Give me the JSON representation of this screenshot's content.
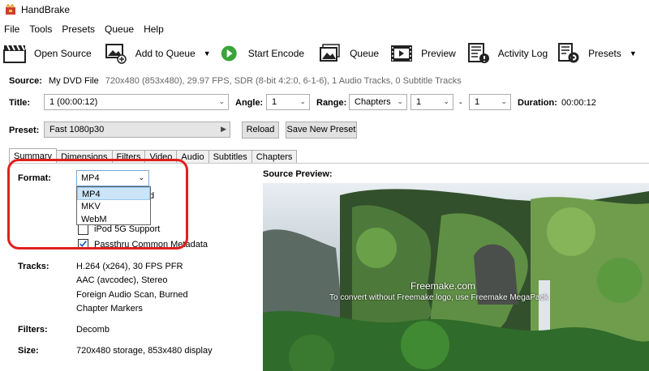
{
  "window": {
    "title": "HandBrake"
  },
  "menu": [
    "File",
    "Tools",
    "Presets",
    "Queue",
    "Help"
  ],
  "toolbar": {
    "open_source": "Open Source",
    "add_to_queue": "Add to Queue",
    "start_encode": "Start Encode",
    "queue": "Queue",
    "preview": "Preview",
    "activity_log": "Activity Log",
    "presets": "Presets"
  },
  "source": {
    "label": "Source:",
    "name": "My DVD File",
    "details": "720x480 (853x480), 29.97 FPS, SDR (8-bit 4:2:0, 6-1-6), 1 Audio Tracks, 0 Subtitle Tracks"
  },
  "title_row": {
    "title_label": "Title:",
    "title_value": "1 (00:00:12)",
    "angle_label": "Angle:",
    "angle_value": "1",
    "range_label": "Range:",
    "range_type": "Chapters",
    "range_start": "1",
    "range_sep": "-",
    "range_end": "1",
    "duration_label": "Duration:",
    "duration_value": "00:00:12"
  },
  "preset_row": {
    "label": "Preset:",
    "value": "Fast 1080p30",
    "reload": "Reload",
    "save_new": "Save New Preset"
  },
  "tabs": [
    "Summary",
    "Dimensions",
    "Filters",
    "Video",
    "Audio",
    "Subtitles",
    "Chapters"
  ],
  "summary": {
    "format_label": "Format:",
    "format_value": "MP4",
    "format_options": [
      "MP4",
      "MKV",
      "WebM"
    ],
    "hidden_option_tail": "d",
    "ipod_label": "iPod 5G Support",
    "passthru_label": "Passthru Common Metadata",
    "tracks_label": "Tracks:",
    "tracks": [
      "H.264 (x264), 30 FPS PFR",
      "AAC (avcodec), Stereo",
      "Foreign Audio Scan, Burned",
      "Chapter Markers"
    ],
    "filters_label": "Filters:",
    "filters_value": "Decomb",
    "size_label": "Size:",
    "size_value": "720x480 storage, 853x480 display"
  },
  "preview": {
    "title": "Source Preview:",
    "watermark_brand": "Freemake.com",
    "watermark_note": "To convert without Freemake logo, use Freemake MegaPack"
  },
  "colors": {
    "annotation": "#e01f1f",
    "dropdown_selected": "#cce4f7"
  }
}
